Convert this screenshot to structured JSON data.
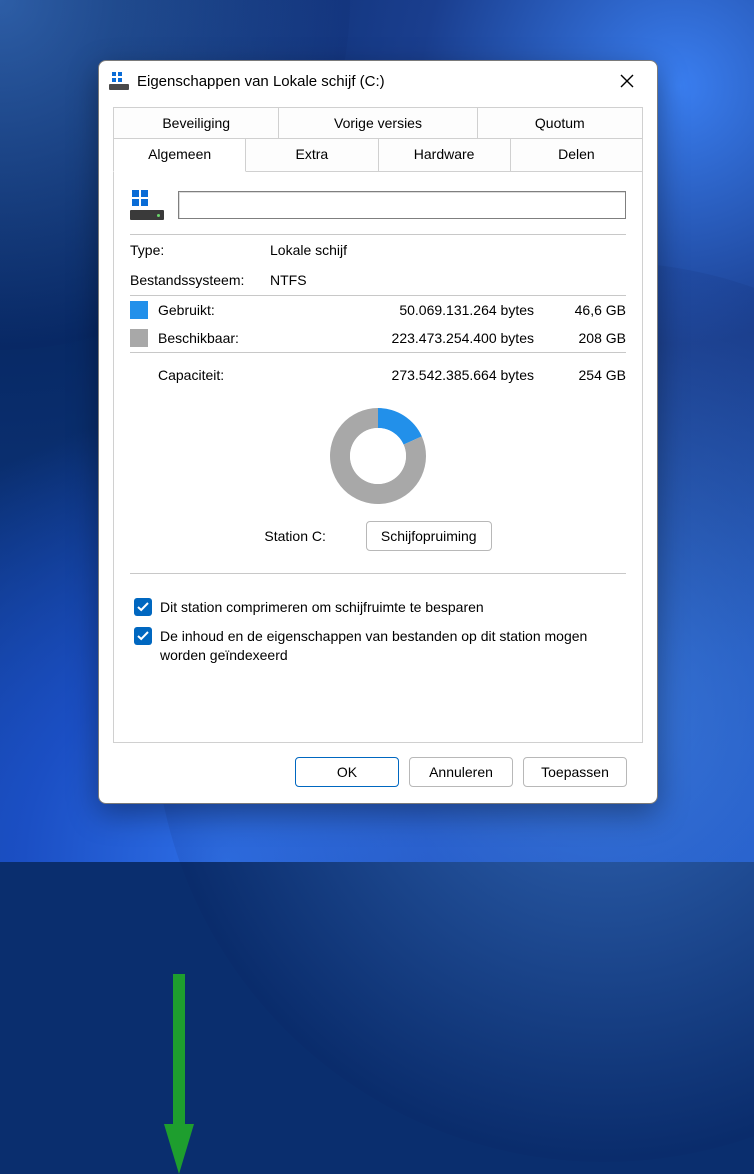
{
  "window": {
    "title": "Eigenschappen van Lokale schijf (C:)"
  },
  "tabs": {
    "row1": [
      "Beveiliging",
      "Vorige versies",
      "Quotum"
    ],
    "row2": [
      "Algemeen",
      "Extra",
      "Hardware",
      "Delen"
    ],
    "active": "Algemeen"
  },
  "drive": {
    "name_value": "",
    "type_label": "Type:",
    "type_value": "Lokale schijf",
    "fs_label": "Bestandssysteem:",
    "fs_value": "NTFS"
  },
  "space": {
    "used_label": "Gebruikt:",
    "used_bytes": "50.069.131.264 bytes",
    "used_gb": "46,6 GB",
    "free_label": "Beschikbaar:",
    "free_bytes": "223.473.254.400 bytes",
    "free_gb": "208 GB",
    "cap_label": "Capaciteit:",
    "cap_bytes": "273.542.385.664 bytes",
    "cap_gb": "254 GB"
  },
  "chart": {
    "station_label": "Station C:",
    "cleanup_button": "Schijfopruiming"
  },
  "checkboxes": {
    "compress": "Dit station comprimeren om schijfruimte te besparen",
    "index": "De inhoud en de eigenschappen van bestanden op dit station mogen worden geïndexeerd"
  },
  "buttons": {
    "ok": "OK",
    "cancel": "Annuleren",
    "apply": "Toepassen"
  },
  "colors": {
    "used": "#2290ea",
    "free": "#a8a8a8",
    "accent": "#0067c0"
  },
  "chart_data": {
    "type": "pie",
    "title": "Station C:",
    "series": [
      {
        "name": "Gebruikt",
        "value": 50069131264,
        "label": "46,6 GB",
        "color": "#2290ea"
      },
      {
        "name": "Beschikbaar",
        "value": 223473254400,
        "label": "208 GB",
        "color": "#a8a8a8"
      }
    ],
    "total": {
      "name": "Capaciteit",
      "value": 273542385664,
      "label": "254 GB"
    },
    "donut": true
  }
}
